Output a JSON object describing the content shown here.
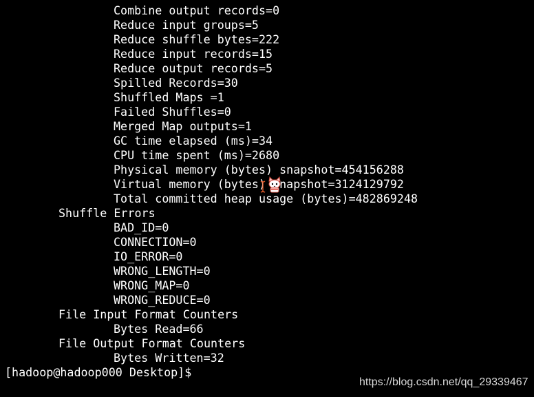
{
  "terminal": {
    "background": "#000000",
    "foreground": "#ffffff",
    "lines": [
      {
        "text": "Combine output records=0",
        "indent": 2
      },
      {
        "text": "Reduce input groups=5",
        "indent": 2
      },
      {
        "text": "Reduce shuffle bytes=222",
        "indent": 2
      },
      {
        "text": "Reduce input records=15",
        "indent": 2
      },
      {
        "text": "Reduce output records=5",
        "indent": 2
      },
      {
        "text": "Spilled Records=30",
        "indent": 2
      },
      {
        "text": "Shuffled Maps =1",
        "indent": 2
      },
      {
        "text": "Failed Shuffles=0",
        "indent": 2
      },
      {
        "text": "Merged Map outputs=1",
        "indent": 2
      },
      {
        "text": "GC time elapsed (ms)=34",
        "indent": 2
      },
      {
        "text": "CPU time spent (ms)=2680",
        "indent": 2
      },
      {
        "text": "Physical memory (bytes) snapshot=454156288",
        "indent": 2
      },
      {
        "text": "Virtual memory (bytes) snapshot=3124129792",
        "indent": 2
      },
      {
        "text": "Total committed heap usage (bytes)=482869248",
        "indent": 2
      },
      {
        "text": "Shuffle Errors",
        "indent": 1
      },
      {
        "text": "BAD_ID=0",
        "indent": 2
      },
      {
        "text": "CONNECTION=0",
        "indent": 2
      },
      {
        "text": "IO_ERROR=0",
        "indent": 2
      },
      {
        "text": "WRONG_LENGTH=0",
        "indent": 2
      },
      {
        "text": "WRONG_MAP=0",
        "indent": 2
      },
      {
        "text": "WRONG_REDUCE=0",
        "indent": 2
      },
      {
        "text": "File Input Format Counters",
        "indent": 1
      },
      {
        "text": "Bytes Read=66",
        "indent": 2
      },
      {
        "text": "File Output Format Counters",
        "indent": 1
      },
      {
        "text": "Bytes Written=32",
        "indent": 2
      },
      {
        "text": "[hadoop@hadoop000 Desktop]$",
        "indent": 0
      }
    ]
  },
  "watermark": {
    "text": "https://blog.csdn.net/qq_29339467"
  },
  "icons": {
    "mascot": "cat-mascot-icon",
    "caret": "text-cursor-icon"
  }
}
